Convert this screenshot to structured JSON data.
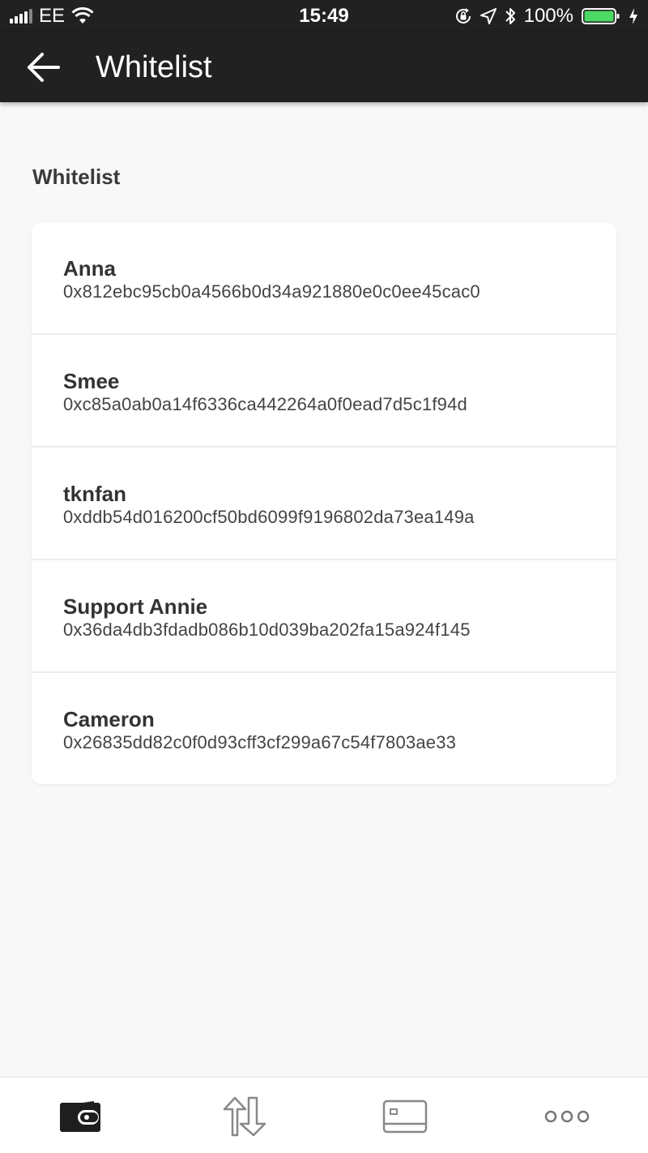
{
  "status_bar": {
    "carrier": "EE",
    "time": "15:49",
    "battery": "100%",
    "icons": [
      "signal-icon",
      "wifi-icon",
      "orientation-lock-icon",
      "location-icon",
      "bluetooth-icon",
      "battery-icon",
      "charging-icon"
    ]
  },
  "header": {
    "title": "Whitelist",
    "back_icon": "arrow-left-icon"
  },
  "section": {
    "title": "Whitelist"
  },
  "whitelist": [
    {
      "name": "Anna",
      "address": "0x812ebc95cb0a4566b0d34a921880e0c0ee45cac0"
    },
    {
      "name": "Smee",
      "address": "0xc85a0ab0a14f6336ca442264a0f0ead7d5c1f94d"
    },
    {
      "name": "tknfan",
      "address": "0xddb54d016200cf50bd6099f9196802da73ea149a"
    },
    {
      "name": "Support Annie",
      "address": "0x36da4db3fdadb086b10d039ba202fa15a924f145"
    },
    {
      "name": "Cameron",
      "address": "0x26835dd82c0f0d93cff3cf299a67c54f7803ae33"
    }
  ],
  "tab_bar": {
    "tabs": [
      "wallet-icon",
      "transfer-icon",
      "card-icon",
      "more-icon"
    ],
    "active": "wallet-icon"
  },
  "colors": {
    "header_bg": "#212121",
    "page_bg": "#f8f8f8",
    "card_bg": "#ffffff",
    "battery_green": "#4cd964"
  }
}
